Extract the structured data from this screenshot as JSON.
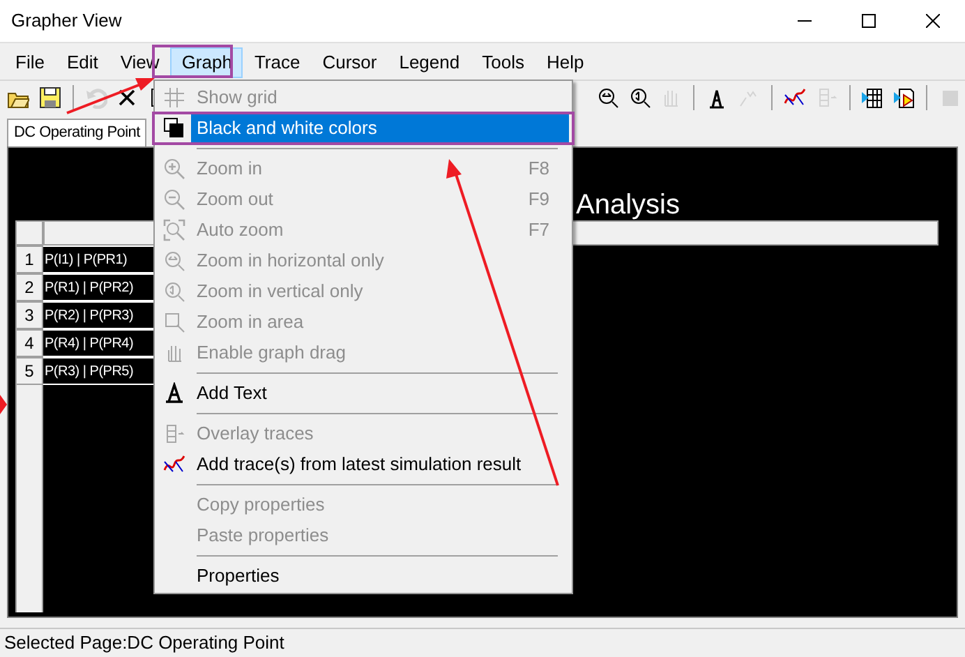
{
  "window": {
    "title": "Grapher View"
  },
  "menu_bar": [
    {
      "label": "File",
      "selected": false
    },
    {
      "label": "Edit",
      "selected": false
    },
    {
      "label": "View",
      "selected": false
    },
    {
      "label": "Graph",
      "selected": true
    },
    {
      "label": "Trace",
      "selected": false
    },
    {
      "label": "Cursor",
      "selected": false
    },
    {
      "label": "Legend",
      "selected": false
    },
    {
      "label": "Tools",
      "selected": false
    },
    {
      "label": "Help",
      "selected": false
    }
  ],
  "toolbar_left": [
    {
      "disabled": false
    },
    {
      "disabled": false
    },
    {
      "disabled": true
    },
    {
      "disabled": false
    },
    {
      "disabled": false
    }
  ],
  "toolbar_right": [
    {
      "disabled": false
    },
    {
      "disabled": false
    },
    {
      "disabled": true
    },
    {
      "disabled": false
    },
    {
      "disabled": true
    },
    {
      "disabled": false
    },
    {
      "disabled": true
    },
    {
      "disabled": false
    },
    {
      "disabled": false
    },
    {
      "disabled": true
    }
  ],
  "tabs": [
    {
      "label": "DC Operating Point",
      "selected": true
    }
  ],
  "graph": {
    "title": "Analysis",
    "rows": [
      {
        "number": "1",
        "label": "P(I1) | P(PR1)"
      },
      {
        "number": "2",
        "label": "P(R1) | P(PR2)"
      },
      {
        "number": "3",
        "label": "P(R2) | P(PR3)"
      },
      {
        "number": "4",
        "label": "P(R4) | P(PR4)"
      },
      {
        "number": "5",
        "label": "P(R3) | P(PR5)"
      }
    ]
  },
  "graph_menu": [
    {
      "kind": "item",
      "label": "Show grid",
      "disabled": true,
      "selected": false
    },
    {
      "kind": "item",
      "label": "Black and white colors",
      "disabled": false,
      "selected": true
    },
    {
      "kind": "separator"
    },
    {
      "kind": "item",
      "label": "Zoom in",
      "shortcut": "F8",
      "disabled": true,
      "selected": false
    },
    {
      "kind": "item",
      "label": "Zoom out",
      "shortcut": "F9",
      "disabled": true,
      "selected": false
    },
    {
      "kind": "item",
      "label": "Auto zoom",
      "shortcut": "F7",
      "disabled": true,
      "selected": false
    },
    {
      "kind": "item",
      "label": "Zoom in horizontal only",
      "disabled": true,
      "selected": false
    },
    {
      "kind": "item",
      "label": "Zoom in vertical only",
      "disabled": true,
      "selected": false
    },
    {
      "kind": "item",
      "label": "Zoom in area",
      "disabled": true,
      "selected": false
    },
    {
      "kind": "item",
      "label": "Enable graph drag",
      "disabled": true,
      "selected": false
    },
    {
      "kind": "separator"
    },
    {
      "kind": "item",
      "label": "Add Text",
      "disabled": false,
      "selected": false
    },
    {
      "kind": "separator"
    },
    {
      "kind": "item",
      "label": "Overlay traces",
      "disabled": true,
      "selected": false
    },
    {
      "kind": "item",
      "label": "Add trace(s) from latest simulation result",
      "disabled": false,
      "selected": false
    },
    {
      "kind": "separator"
    },
    {
      "kind": "item",
      "label": "Copy properties",
      "disabled": true,
      "selected": false
    },
    {
      "kind": "item",
      "label": "Paste properties",
      "disabled": true,
      "selected": false
    },
    {
      "kind": "separator"
    },
    {
      "kind": "item",
      "label": "Properties",
      "disabled": false,
      "selected": false
    }
  ],
  "status_bar": {
    "text": "Selected Page:DC Operating Point"
  }
}
